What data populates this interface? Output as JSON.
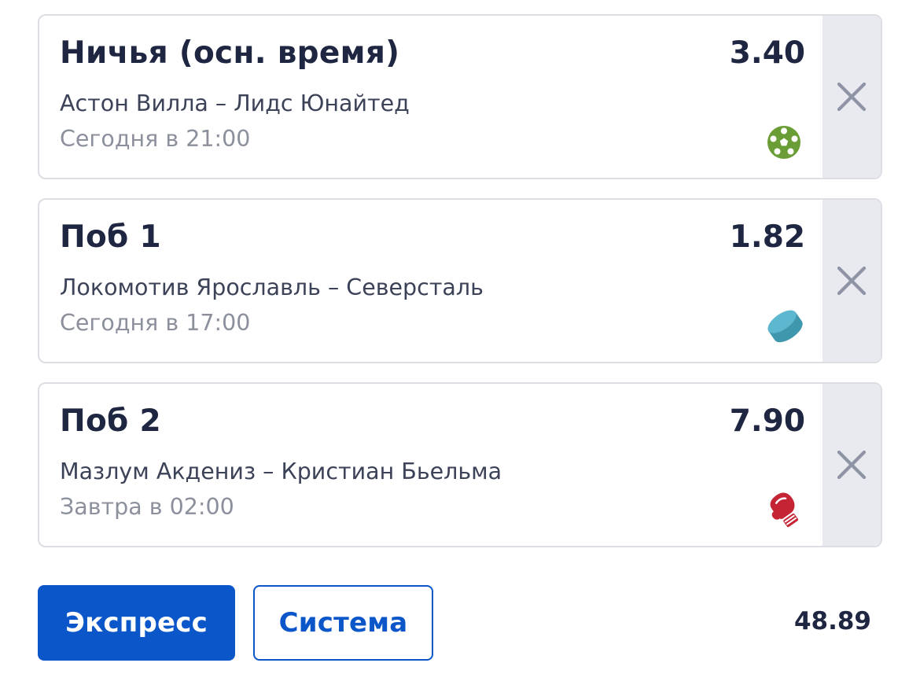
{
  "colors": {
    "text_primary": "#1f2641",
    "text_secondary": "#3c4258",
    "text_muted": "#8c909d",
    "card_border": "#dcdee4",
    "remove_bg": "#e9eaef",
    "remove_icon": "#8e93a6",
    "accent": "#0b56c9",
    "football_icon": "#6a9d35",
    "hockey_icon": "#4aa8c0",
    "boxing_icon": "#c42433"
  },
  "bets": [
    {
      "title": "Ничья (осн. время)",
      "odds": "3.40",
      "match": "Астон Вилла – Лидс Юнайтед",
      "time": "Сегодня в 21:00",
      "sport_icon": "football-icon",
      "remove_icon": "close-icon"
    },
    {
      "title": "Поб 1",
      "odds": "1.82",
      "match": "Локомотив Ярославль – Северсталь",
      "time": "Сегодня в 17:00",
      "sport_icon": "hockey-puck-icon",
      "remove_icon": "close-icon"
    },
    {
      "title": "Поб 2",
      "odds": "7.90",
      "match": "Мазлум Акдениз – Кристиан Бьельма",
      "time": "Завтра в 02:00",
      "sport_icon": "boxing-glove-icon",
      "remove_icon": "close-icon"
    }
  ],
  "bet_type": {
    "express_label": "Экспресс",
    "system_label": "Система",
    "selected": "Экспресс"
  },
  "total_odds": "48.89"
}
